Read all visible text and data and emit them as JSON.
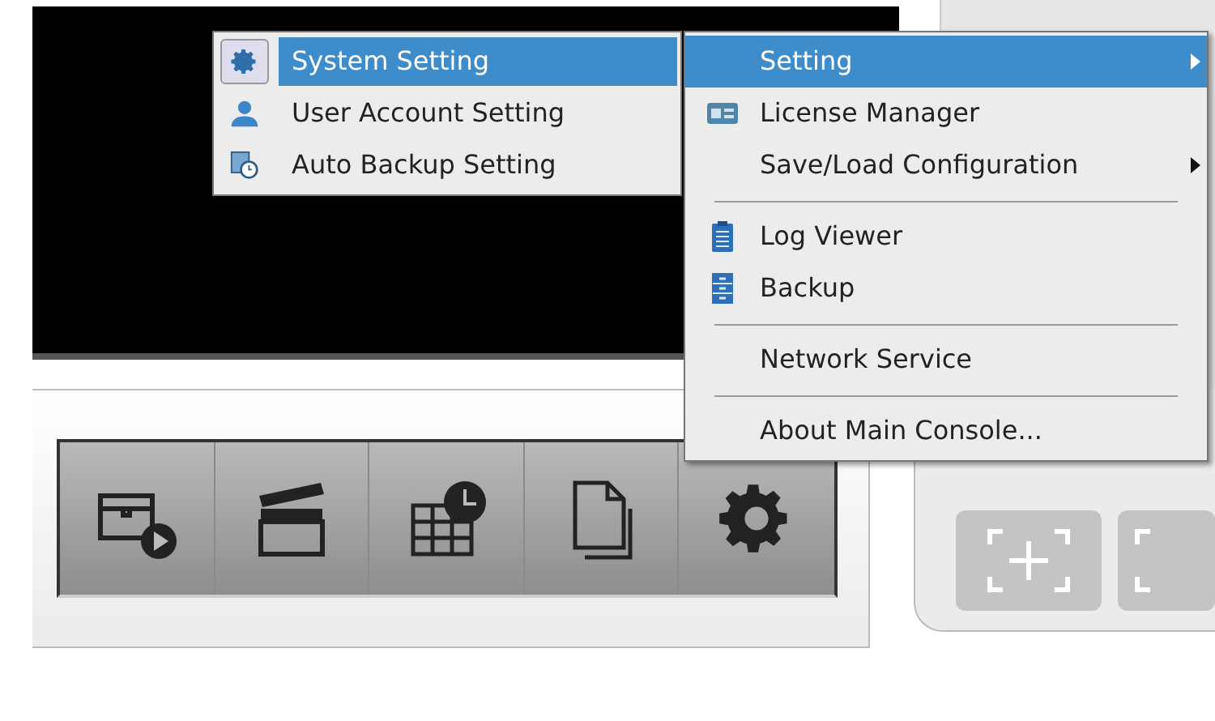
{
  "submenu": {
    "items": [
      {
        "label": "System Setting",
        "selected": true
      },
      {
        "label": "User Account Setting",
        "selected": false
      },
      {
        "label": "Auto Backup Setting",
        "selected": false
      }
    ]
  },
  "main_menu": {
    "items": [
      {
        "kind": "item",
        "label": "Setting",
        "selected": true,
        "has_submenu": true
      },
      {
        "kind": "item",
        "label": "License Manager",
        "selected": false,
        "has_submenu": false
      },
      {
        "kind": "item",
        "label": "Save/Load Configuration",
        "selected": false,
        "has_submenu": true
      },
      {
        "kind": "separator"
      },
      {
        "kind": "item",
        "label": "Log Viewer",
        "selected": false,
        "has_submenu": false
      },
      {
        "kind": "item",
        "label": "Backup",
        "selected": false,
        "has_submenu": false
      },
      {
        "kind": "separator"
      },
      {
        "kind": "item",
        "label": "Network Service",
        "selected": false,
        "has_submenu": false
      },
      {
        "kind": "separator"
      },
      {
        "kind": "item",
        "label": "About Main Console...",
        "selected": false,
        "has_submenu": false
      }
    ]
  }
}
